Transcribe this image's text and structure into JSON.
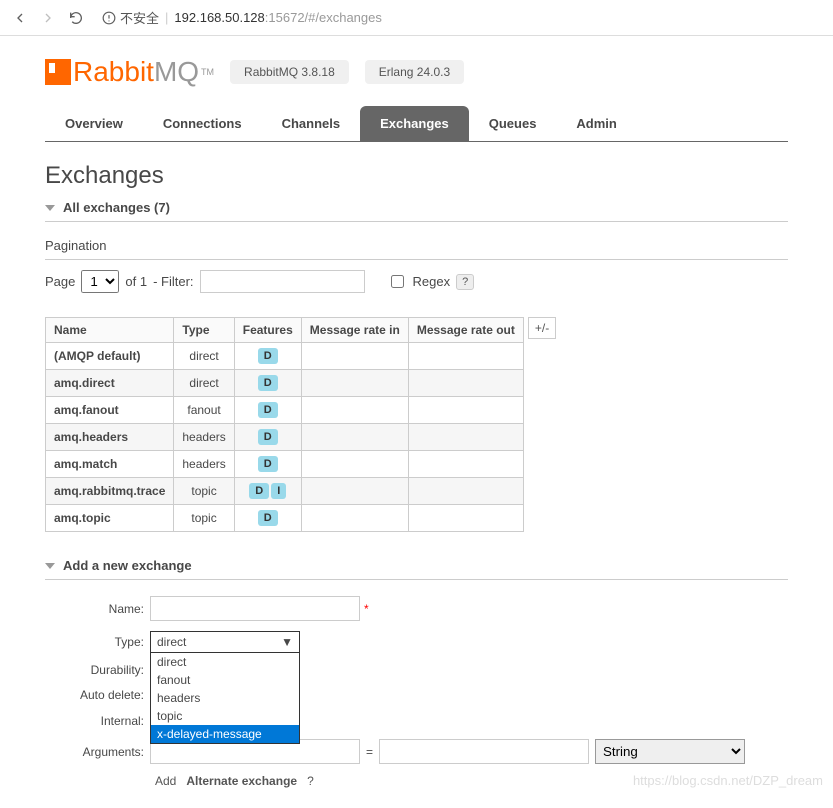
{
  "browser": {
    "insecure_label": "不安全",
    "url_ip": "192.168.50.128",
    "url_port": ":15672/#/exchanges"
  },
  "logo": {
    "rabbit": "Rabbit",
    "mq": "MQ",
    "tm": "TM"
  },
  "versions": {
    "rabbitmq": "RabbitMQ 3.8.18",
    "erlang": "Erlang 24.0.3"
  },
  "tabs": {
    "overview": "Overview",
    "connections": "Connections",
    "channels": "Channels",
    "exchanges": "Exchanges",
    "queues": "Queues",
    "admin": "Admin"
  },
  "page_title": "Exchanges",
  "section_all": "All exchanges (7)",
  "pagination_label": "Pagination",
  "filter": {
    "page_label": "Page",
    "page_value": "1",
    "of_label": "of 1",
    "dash_filter": "- Filter:",
    "regex_label": "Regex",
    "help": "?"
  },
  "table": {
    "headers": {
      "name": "Name",
      "type": "Type",
      "features": "Features",
      "rate_in": "Message rate in",
      "rate_out": "Message rate out"
    },
    "plus_minus": "+/-",
    "rows": [
      {
        "name": "(AMQP default)",
        "type": "direct",
        "features": [
          "D"
        ]
      },
      {
        "name": "amq.direct",
        "type": "direct",
        "features": [
          "D"
        ]
      },
      {
        "name": "amq.fanout",
        "type": "fanout",
        "features": [
          "D"
        ]
      },
      {
        "name": "amq.headers",
        "type": "headers",
        "features": [
          "D"
        ]
      },
      {
        "name": "amq.match",
        "type": "headers",
        "features": [
          "D"
        ]
      },
      {
        "name": "amq.rabbitmq.trace",
        "type": "topic",
        "features": [
          "D",
          "I"
        ]
      },
      {
        "name": "amq.topic",
        "type": "topic",
        "features": [
          "D"
        ]
      }
    ]
  },
  "add_section_title": "Add a new exchange",
  "form": {
    "name_label": "Name:",
    "type_label": "Type:",
    "durability_label": "Durability:",
    "autodelete_label": "Auto delete:",
    "internal_label": "Internal:",
    "arguments_label": "Arguments:",
    "type_selected": "direct",
    "type_options": [
      "direct",
      "fanout",
      "headers",
      "topic",
      "x-delayed-message"
    ],
    "arg_eq": "=",
    "arg_type": "String",
    "help": "?",
    "add_btn": "Add",
    "alt_exchange": "Alternate exchange"
  },
  "watermark": "https://blog.csdn.net/DZP_dream"
}
